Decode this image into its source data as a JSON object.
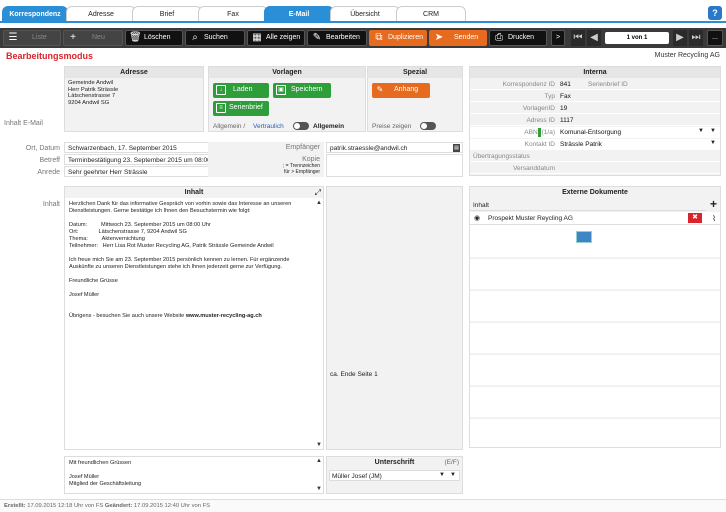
{
  "tabs": [
    "Korrespondenz",
    "Adresse",
    "Brief",
    "Fax",
    "E-Mail",
    "Übersicht",
    "CRM"
  ],
  "toolbar": {
    "liste": "Liste",
    "neu": "Neu",
    "loeschen": "Löschen",
    "suchen": "Suchen",
    "alle": "Alle zeigen",
    "bearbeiten": "Bearbeiten",
    "duplizieren": "Duplizieren",
    "senden": "Senden",
    "drucken": "Drucken",
    "more": ">",
    "pageinfo": "1 von 1",
    "dots": "..."
  },
  "header": {
    "mode": "Bearbeitungsmodus",
    "company": "Muster Recycling AG",
    "help": "?"
  },
  "adresse": {
    "title": "Adresse",
    "lines": [
      "Gemeinde Andwil",
      "Herr Patrik Strässle",
      "Lätschenstrasse 7",
      "9204 Andwil SG"
    ],
    "side_label": "Inhalt E-Mail"
  },
  "vorlagen": {
    "title": "Vorlagen",
    "laden": "Laden",
    "speichern": "Speichern",
    "serienbrief": "Serienbrief",
    "toggle_left": "Allgemein /",
    "toggle_link": "Vertraulich",
    "toggle_right": "Allgemein"
  },
  "spezial": {
    "title": "Spezial",
    "anhang": "Anhang",
    "preise": "Preise zeigen"
  },
  "interna": {
    "title": "Interna",
    "rows": [
      {
        "k": "Korrespondenz ID",
        "v": "841",
        "k2": "Serienbrief ID"
      },
      {
        "k": "Typ",
        "v": "Fax"
      },
      {
        "k": "VorlagenID",
        "v": "19"
      },
      {
        "k": "Adress ID",
        "v": "1117"
      },
      {
        "k": "ABNr (1/a)",
        "v": "Komunal-Entsorgung"
      },
      {
        "k": "Kontakt ID",
        "v": "Strässle Patrik"
      },
      {
        "k": "Übertragungsstatus",
        "v": ""
      },
      {
        "k": "Versanddatum",
        "v": ""
      }
    ]
  },
  "meta": {
    "ort_label": "Ort, Datum",
    "ort_val": "Schwarzenbach, 17. September 2015",
    "betreff_label": "Betreff",
    "betreff_val": "Terminbestätigung 23. September 2015 um 08:00 Uhr",
    "anrede_label": "Anrede",
    "anrede_val": "Sehr geehrter Herr Strässle",
    "empf_label": "Empfänger",
    "empf_val": "patrik.straessle@andwil.ch",
    "kopie_label": "Kopie",
    "kopie_hint": "; = Trennzeichen\nfür > Empfänger"
  },
  "inhalt": {
    "title": "Inhalt",
    "side_label": "Inhalt",
    "body": "Herzlichen Dank für das informative Gespräch von vorhin sowie das Interesse an unseren\nDienstleistungen. Gerne bestätige ich Ihnen den Besuchstermin wie folgt:\n\nDatum:         Mittwoch 23. September 2015 um 08:00 Uhr\nOrt:             Lätschenstrasse 7, 9204 Andwil SG\nThema:         Aktenvernichtung\nTeilnehmer:   Herr Lisa Rot Muster Recycling AG, Patrik Strässle Gemeinde Andwil\n\nIch freue mich Sie am 23. September 2015 persönlich kennen zu lernen. Für ergänzende\nAuskünfte zu unseren Dienstleistungen stehe ich Ihnen jederzeit gerne zur Verfügung.\n\nFreundliche Grüsse\n\nJosef Müller\n\n\nÜbrigens - besuchen Sie auch unsere Website",
    "website": "www.muster-recycling-ag.ch",
    "end_page": "ca. Ende Seite 1"
  },
  "signature": {
    "text": "Mit freundlichen Grüssen\n\nJosef Müller\nMitglied der Geschäftsleitung",
    "title": "Unterschrift",
    "ef": "(E/F)",
    "name": "Müller Josef (JM)"
  },
  "externe": {
    "title": "Externe Dokumente",
    "col": "Inhalt",
    "item": "Prospekt Muster Reycling AG"
  },
  "footer": {
    "erstellt_l": "Erstellt:",
    "erstellt_v": "17.09.2015 12:18 Uhr von FS",
    "geaendert_l": "Geändert:",
    "geaendert_v": "17.09.2015 12:40 Uhr von FS"
  },
  "colors": {
    "accent": "#2a8fd6",
    "green": "#2e9e3a",
    "orange": "#e66b1f",
    "red": "#d9242b"
  }
}
